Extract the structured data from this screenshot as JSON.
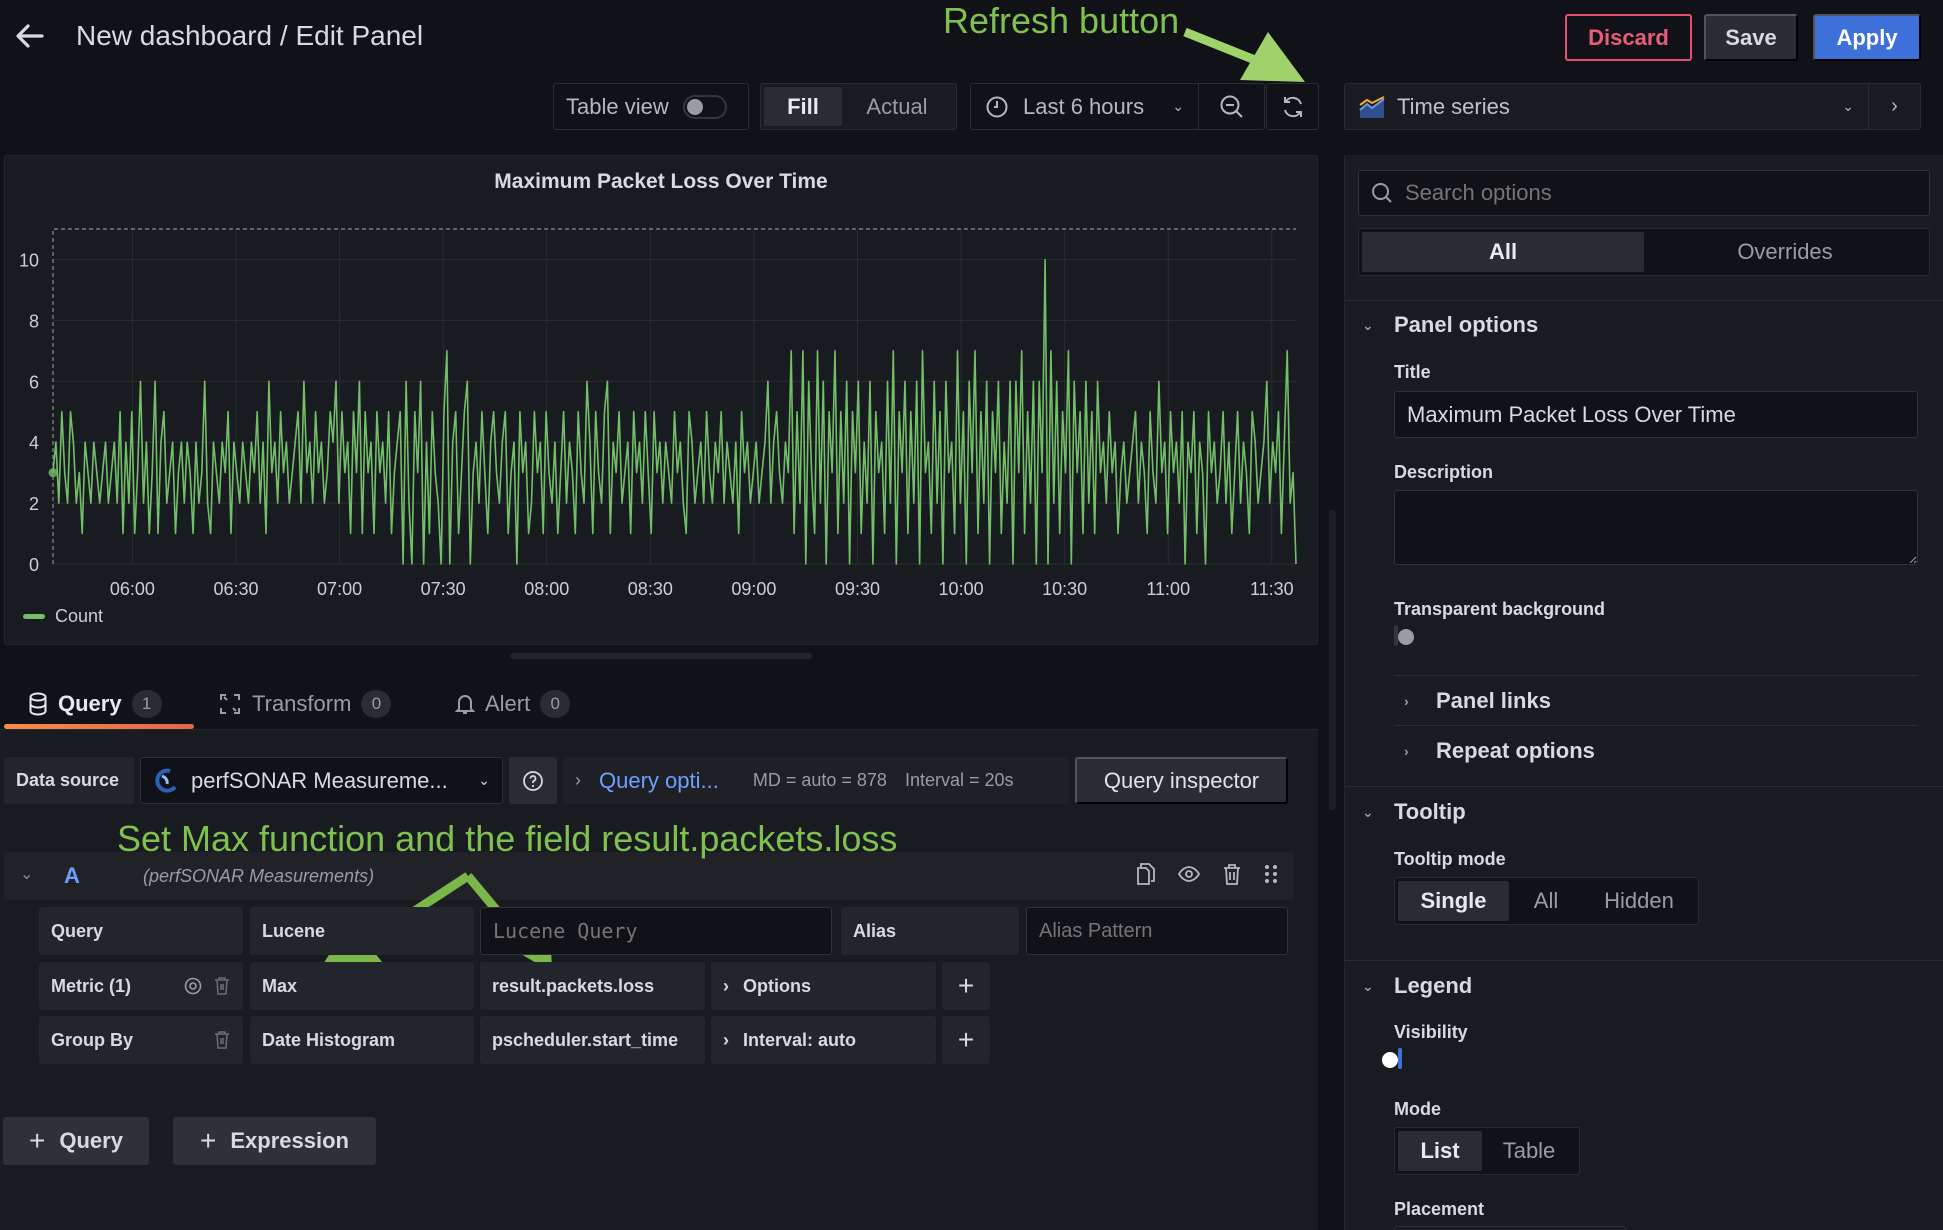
{
  "header": {
    "title": "New dashboard / Edit Panel",
    "discard_label": "Discard",
    "save_label": "Save",
    "apply_label": "Apply"
  },
  "toolbar": {
    "table_view_label": "Table view",
    "table_view_on": false,
    "fill_label": "Fill",
    "actual_label": "Actual",
    "fill_mode_selected": "Fill",
    "time_range": "Last 6 hours",
    "visualization": "Time series"
  },
  "annotations": {
    "refresh": "Refresh button",
    "query": "Set Max function and the field result.packets.loss",
    "color": "#80c04f"
  },
  "colors": {
    "series": "#73bf69",
    "accent_blue": "#3d71d9",
    "discard_red": "#ea5c7a",
    "tab_underline": "#f78c44"
  },
  "chart_data": {
    "type": "line",
    "title": "Maximum Packet Loss Over Time",
    "xlabel": "",
    "ylabel": "",
    "x_tick_labels": [
      "06:00",
      "06:30",
      "07:00",
      "07:30",
      "08:00",
      "08:30",
      "09:00",
      "09:30",
      "10:00",
      "10:30",
      "11:00",
      "11:30"
    ],
    "x_range": [
      "05:37",
      "11:37"
    ],
    "y_tick_labels": [
      "0",
      "2",
      "4",
      "6",
      "8",
      "10"
    ],
    "ylim": [
      0,
      11
    ],
    "grid": true,
    "legend_placement": "bottom-left",
    "series": [
      {
        "name": "Count",
        "color": "#73bf69",
        "summary": {
          "typical_min": 2,
          "typical_max": 4,
          "baseline": 3,
          "peak": 10,
          "peak_time": "10:28",
          "min": 0
        },
        "values": [
          3,
          4,
          2,
          5,
          3,
          2,
          5,
          4,
          2,
          3,
          1,
          4,
          3,
          2,
          4,
          3,
          2,
          3,
          4,
          2,
          3,
          4,
          2,
          5,
          1,
          4,
          2,
          5,
          1,
          3,
          6,
          2,
          4,
          1,
          3,
          6,
          1,
          4,
          5,
          2,
          3,
          4,
          1,
          3,
          4,
          2,
          4,
          3,
          1,
          4,
          2,
          3,
          6,
          2,
          1,
          4,
          3,
          2,
          4,
          3,
          5,
          1,
          4,
          3,
          2,
          4,
          3,
          2,
          4,
          3,
          5,
          2,
          4,
          1,
          6,
          3,
          4,
          2,
          5,
          3,
          4,
          2,
          3,
          4,
          5,
          2,
          6,
          3,
          4,
          2,
          5,
          3,
          4,
          2,
          3,
          5,
          4,
          6,
          2,
          5,
          3,
          4,
          1,
          5,
          3,
          6,
          1,
          5,
          3,
          4,
          1,
          5,
          3,
          4,
          2,
          5,
          1,
          3,
          4,
          5,
          0,
          6,
          2,
          0,
          5,
          3,
          6,
          0,
          4,
          1,
          5,
          3,
          2,
          0,
          5,
          7,
          0,
          4,
          5,
          1,
          3,
          5,
          6,
          0,
          3,
          4,
          2,
          5,
          3,
          1,
          4,
          5,
          3,
          2,
          4,
          5,
          1,
          3,
          4,
          0,
          5,
          3,
          4,
          1,
          2,
          5,
          3,
          4,
          1,
          5,
          3,
          2,
          4,
          1,
          3,
          5,
          2,
          4,
          3,
          1,
          5,
          3,
          2,
          6,
          4,
          1,
          5,
          3,
          2,
          5,
          6,
          1,
          4,
          3,
          5,
          2,
          3,
          4,
          1,
          5,
          3,
          4,
          2,
          5,
          3,
          1,
          5,
          3,
          4,
          2,
          4,
          3,
          2,
          5,
          3,
          4,
          2,
          1,
          5,
          4,
          2,
          3,
          4,
          2,
          5,
          3,
          2,
          4,
          3,
          5,
          2,
          4,
          3,
          2,
          4,
          1,
          5,
          3,
          4,
          2,
          3,
          4,
          2,
          3,
          4,
          6,
          2,
          4,
          5,
          3,
          2,
          4,
          3,
          7,
          1,
          5,
          2,
          7,
          0,
          6,
          3,
          1,
          7,
          2,
          6,
          0,
          5,
          3,
          7,
          1,
          5,
          2,
          6,
          0,
          5,
          3,
          6,
          1,
          4,
          2,
          6,
          0,
          5,
          3,
          4,
          1,
          6,
          2,
          7,
          0,
          5,
          3,
          6,
          1,
          5,
          2,
          6,
          0,
          7,
          3,
          4,
          1,
          6,
          2,
          5,
          0,
          6,
          3,
          4,
          1,
          7,
          2,
          5,
          0,
          6,
          3,
          7,
          1,
          5,
          2,
          6,
          0,
          5,
          3,
          6,
          1,
          4,
          2,
          6,
          0,
          6,
          3,
          7,
          1,
          5,
          2,
          6,
          0,
          6,
          3,
          10,
          0,
          7,
          2,
          6,
          1,
          5,
          3,
          7,
          0,
          6,
          3,
          5,
          1,
          6,
          2,
          5,
          1,
          6,
          3,
          4,
          2,
          5,
          3,
          4,
          1,
          3,
          4,
          2,
          3,
          4,
          5,
          2,
          4,
          3,
          1,
          5,
          3,
          2,
          6,
          3,
          4,
          1,
          5,
          3,
          4,
          2,
          5,
          0,
          4,
          3,
          5,
          1,
          4,
          3,
          0,
          5,
          3,
          4,
          2,
          3,
          5,
          2,
          4,
          1,
          3,
          5,
          2,
          4,
          3,
          1,
          5,
          4,
          2,
          3,
          4,
          6,
          2,
          4,
          3,
          5,
          1,
          4,
          7,
          2,
          3,
          0
        ]
      }
    ]
  },
  "tabs": [
    {
      "label": "Query",
      "count": "1",
      "active": true
    },
    {
      "label": "Transform",
      "count": "0",
      "active": false
    },
    {
      "label": "Alert",
      "count": "0",
      "active": false
    }
  ],
  "datasource": {
    "label": "Data source",
    "value": "perfSONAR Measureme...",
    "query_options_label": "Query opti...",
    "md": "MD = auto = 878",
    "interval": "Interval = 20s",
    "inspector_label": "Query inspector"
  },
  "query": {
    "ref_id": "A",
    "datasource_name": "(perfSONAR Measurements)",
    "rows": {
      "query_label": "Query",
      "query_type": "Lucene",
      "lucene_placeholder": "Lucene Query",
      "lucene_value": "",
      "alias_label": "Alias",
      "alias_placeholder": "Alias Pattern",
      "metric_label": "Metric (1)",
      "metric_type": "Max",
      "metric_field": "result.packets.loss",
      "metric_options": "Options",
      "groupby_label": "Group By",
      "groupby_type": "Date Histogram",
      "groupby_field": "pscheduler.start_time",
      "groupby_options": "Interval: auto"
    },
    "add_query_label": "Query",
    "add_expression_label": "Expression"
  },
  "options": {
    "search_placeholder": "Search options",
    "tab_all": "All",
    "tab_overrides": "Overrides",
    "panel_options": {
      "header": "Panel options",
      "title_label": "Title",
      "title_value": "Maximum Packet Loss Over Time",
      "description_label": "Description",
      "description_value": "",
      "transparent_label": "Transparent background",
      "transparent_on": false,
      "panel_links": "Panel links",
      "repeat_options": "Repeat options"
    },
    "tooltip": {
      "header": "Tooltip",
      "mode_label": "Tooltip mode",
      "modes": [
        "Single",
        "All",
        "Hidden"
      ],
      "selected": "Single"
    },
    "legend": {
      "header": "Legend",
      "visibility_label": "Visibility",
      "visibility_on": true,
      "mode_label": "Mode",
      "modes": [
        "List",
        "Table"
      ],
      "selected": "List",
      "placement_label": "Placement"
    }
  }
}
